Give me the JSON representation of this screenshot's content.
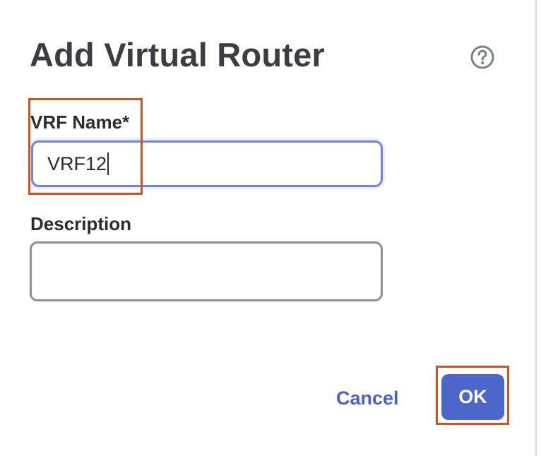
{
  "dialog": {
    "title": "Add Virtual Router",
    "help_icon": "help-circle-icon"
  },
  "form": {
    "vrf_name": {
      "label": "VRF Name*",
      "value": "VRF12",
      "focused": true
    },
    "description": {
      "label": "Description",
      "value": ""
    }
  },
  "actions": {
    "cancel_label": "Cancel",
    "ok_label": "OK"
  },
  "colors": {
    "accent": "#4d66cc",
    "title_text": "#3b3d43",
    "focus_border": "#6f86d6",
    "annotation": "#cf5423"
  }
}
